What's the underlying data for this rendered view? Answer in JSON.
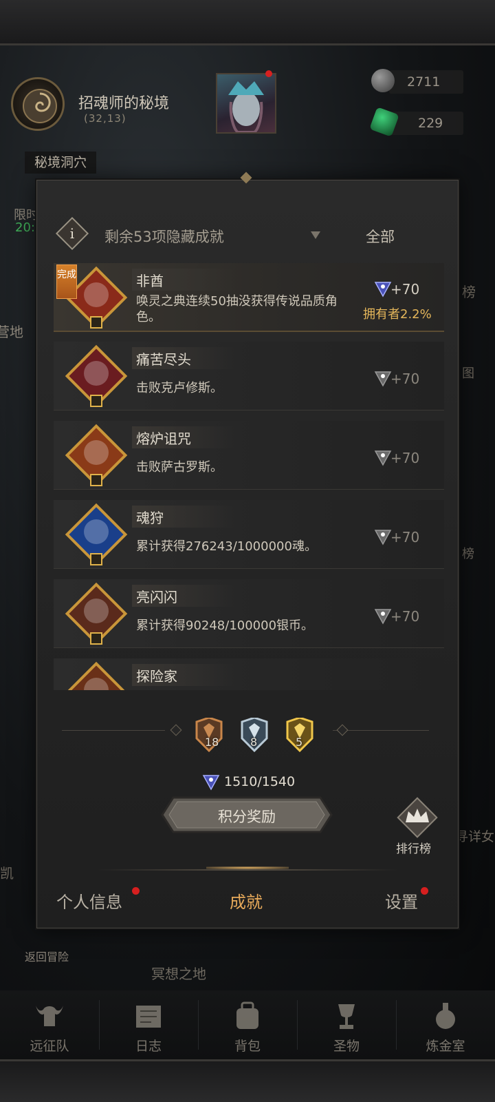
{
  "hud": {
    "location_title": "招魂师的秘境",
    "location_coords": "(32,13)",
    "sub_location": "秘境洞穴",
    "resource_1_value": "2711",
    "resource_2_value": "229",
    "camp_label": "营地",
    "side_label_left_1": "限时",
    "side_label_left_2": "20:",
    "side_label_right_1": "榜",
    "side_label_right_2": "图",
    "side_label_right_3": "榜",
    "side_label_right_4": "寻详女",
    "side_label_left_3": "凯",
    "return_label": "返回冒险",
    "place_label": "冥想之地"
  },
  "filter": {
    "text": "剩余53项隐藏成就",
    "all_label": "全部"
  },
  "achievements": [
    {
      "done_tag": "完成",
      "title": "非酋",
      "desc": "唤灵之典连续50抽没获得传说品质角色。",
      "reward": "+70",
      "owners": "拥有者2.2%",
      "badge_color": "#8a2a1a",
      "icon": "shaman-mask-icon"
    },
    {
      "title": "痛苦尽头",
      "desc": "击败克卢修斯。",
      "reward": "+70",
      "badge_color": "#6a1c20",
      "icon": "skeleton-knight-icon"
    },
    {
      "title": "熔炉诅咒",
      "desc": "击败萨古罗斯。",
      "reward": "+70",
      "badge_color": "#8a3a18",
      "icon": "fire-beast-icon"
    },
    {
      "title": "魂狩",
      "desc": "累计获得276243/1000000魂。",
      "reward": "+70",
      "badge_color": "#1a3f8a",
      "icon": "blue-soul-flame-icon"
    },
    {
      "title": "亮闪闪",
      "desc": "累计获得90248/100000银币。",
      "reward": "+70",
      "badge_color": "#5a2a1c",
      "icon": "silver-coins-icon"
    },
    {
      "title": "探险家",
      "desc": "",
      "reward": "",
      "badge_color": "#6a3018",
      "icon": "explorer-icon"
    }
  ],
  "medals": {
    "bronze_count": "18",
    "silver_count": "8",
    "gold_count": "5"
  },
  "points": {
    "text": "1510/1540"
  },
  "buttons": {
    "reward_label": "积分奖励",
    "rank_label": "排行榜"
  },
  "tabs": {
    "profile": "个人信息",
    "achievements": "成就",
    "settings": "设置"
  },
  "nav": {
    "items": [
      "远征队",
      "日志",
      "背包",
      "圣物",
      "炼金室"
    ]
  },
  "colors": {
    "accent_gold": "#e4b65a",
    "active_tab": "#e6a95a",
    "notify_red": "#d61f1f"
  }
}
